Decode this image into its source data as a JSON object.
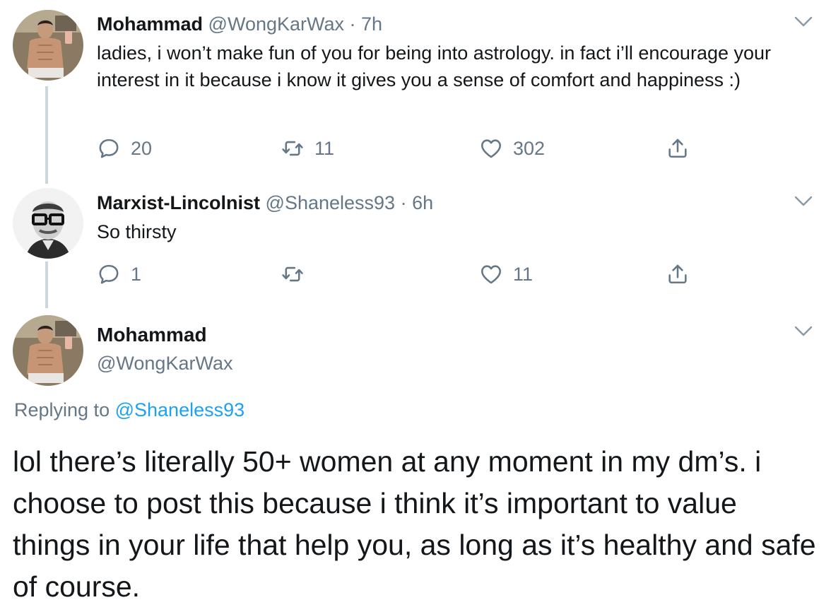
{
  "tweets": [
    {
      "name": "Mohammad",
      "handle": "@WongKarWax",
      "time": "· 7h",
      "text": "ladies, i won’t make fun of you for being into astrology. in fact i’ll encourage your interest in it because i know it gives you a sense of comfort and happiness :)",
      "replies": "20",
      "retweets": "11",
      "likes": "302"
    },
    {
      "name": "Marxist-Lincolnist",
      "handle": "@Shaneless93",
      "time": "· 6h",
      "text": "So thirsty",
      "replies": "1",
      "retweets": "",
      "likes": "11"
    }
  ],
  "main_tweet": {
    "name": "Mohammad",
    "handle": "@WongKarWax",
    "replying_prefix": "Replying to",
    "replying_to": "@Shaneless93",
    "text": "lol there’s literally 50+ women at any moment in my dm’s. i choose to post this because i think it’s important to value things in your life that help you, as long as it’s healthy and safe of course."
  },
  "icons": {
    "reply": "reply-icon",
    "retweet": "retweet-icon",
    "like": "heart-icon",
    "share": "share-icon",
    "more": "chevron-down-icon"
  },
  "colors": {
    "text": "#14171a",
    "secondary": "#657786",
    "link": "#1da1f2",
    "thread_line": "#ccd6dd"
  }
}
